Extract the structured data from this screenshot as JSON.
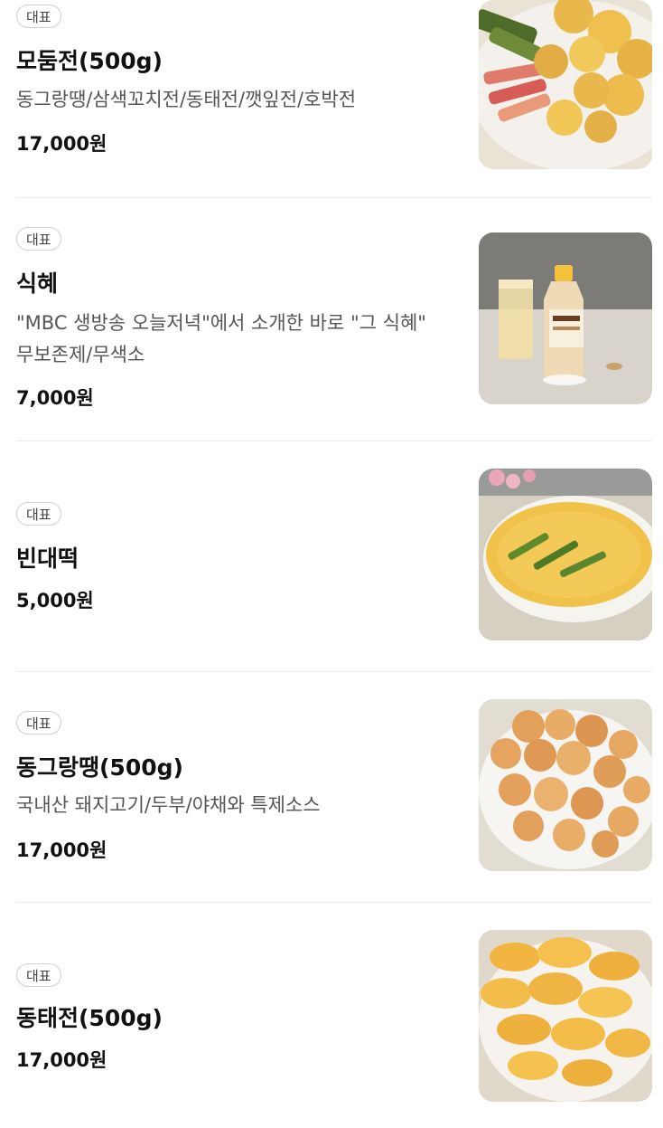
{
  "menu": {
    "items": [
      {
        "badge": "대표",
        "name": "모둠전(500g)",
        "description": "동그랑땡/삼색꼬치전/동태전/깻잎전/호박전",
        "price": "17,000원",
        "image_icon": "assorted-jeon-photo-icon"
      },
      {
        "badge": "대표",
        "name": "식혜",
        "description": "\"MBC 생방송 오늘저녁\"에서 소개한 바로 \"그 식혜\" 무보존제/무색소",
        "price": "7,000원",
        "image_icon": "sikhye-bottle-photo-icon"
      },
      {
        "badge": "대표",
        "name": "빈대떡",
        "description": "",
        "price": "5,000원",
        "image_icon": "bindaetteok-photo-icon"
      },
      {
        "badge": "대표",
        "name": "동그랑땡(500g)",
        "description": "국내산 돼지고기/두부/야채와 특제소스",
        "price": "17,000원",
        "image_icon": "donggeurangttaeng-photo-icon"
      },
      {
        "badge": "대표",
        "name": "동태전(500g)",
        "description": "",
        "price": "17,000원",
        "image_icon": "dongtaejeon-photo-icon"
      }
    ]
  },
  "colors": {
    "background": "#ffffff",
    "text_primary": "#111111",
    "text_secondary": "#555555",
    "badge_border": "#cfcfcf",
    "divider": "#ececec"
  }
}
